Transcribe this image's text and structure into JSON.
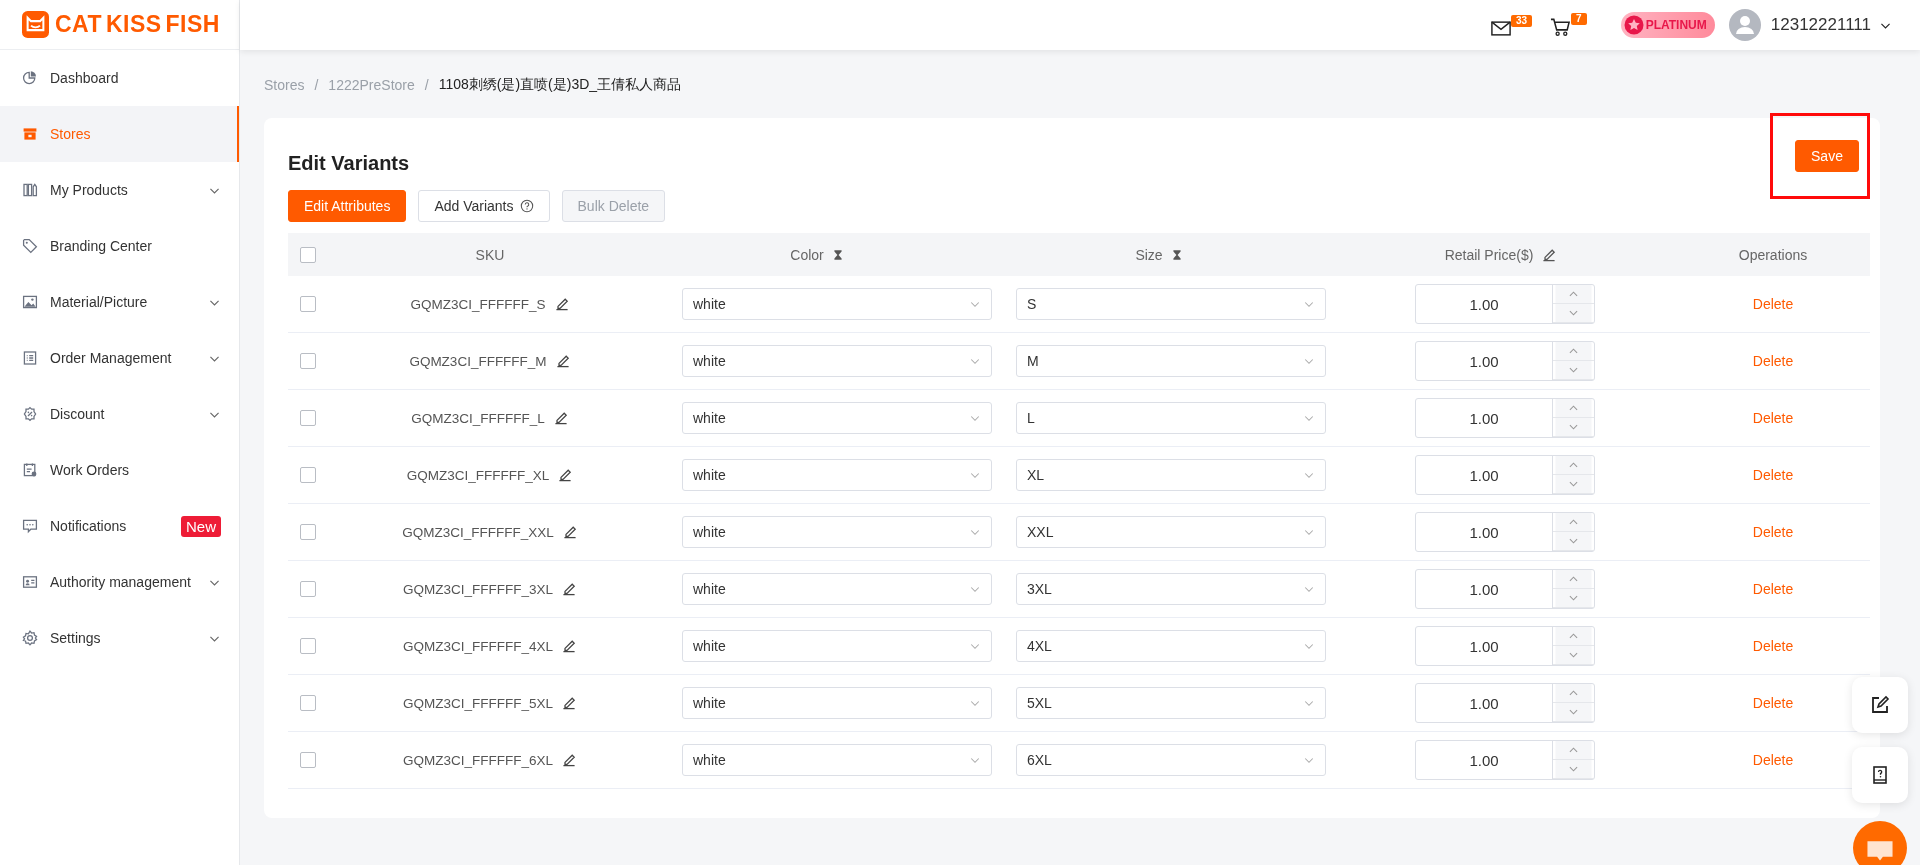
{
  "header": {
    "logo": "CAT KISS FISH",
    "mail_count": "33",
    "cart_count": "7",
    "level_badge": "PLATINUM",
    "username": "12312221111"
  },
  "sidebar": {
    "items": [
      {
        "label": "Dashboard",
        "selected": false,
        "expandable": false
      },
      {
        "label": "Stores",
        "selected": true,
        "expandable": false
      },
      {
        "label": "My Products",
        "selected": false,
        "expandable": true
      },
      {
        "label": "Branding Center",
        "selected": false,
        "expandable": false
      },
      {
        "label": "Material/Picture",
        "selected": false,
        "expandable": true
      },
      {
        "label": "Order Management",
        "selected": false,
        "expandable": true
      },
      {
        "label": "Discount",
        "selected": false,
        "expandable": true
      },
      {
        "label": "Work Orders",
        "selected": false,
        "expandable": false
      },
      {
        "label": "Notifications",
        "selected": false,
        "expandable": false,
        "badge": "New"
      },
      {
        "label": "Authority management",
        "selected": false,
        "expandable": true
      },
      {
        "label": "Settings",
        "selected": false,
        "expandable": true
      }
    ]
  },
  "breadcrumb": [
    {
      "label": "Stores"
    },
    {
      "separator": "/",
      "label": "1222PreStore"
    },
    {
      "separator": "/",
      "label": "1108刺绣(是)直喷(是)3D_王倩私人商品"
    }
  ],
  "card": {
    "title": "Edit Variants",
    "save_button": "Save",
    "save_highlighted": true,
    "buttons": [
      {
        "label": "Edit Attributes",
        "kind": "primary",
        "help": false,
        "disabled": false
      },
      {
        "label": "Add Variants",
        "kind": "default",
        "help": true,
        "disabled": false
      },
      {
        "label": "Bulk Delete",
        "kind": "default",
        "help": false,
        "disabled": true
      }
    ]
  },
  "table": {
    "all_checked": false,
    "columns": [
      {
        "label": "SKU",
        "kind": "plain"
      },
      {
        "label": "Color",
        "kind": "sortable"
      },
      {
        "label": "Size",
        "kind": "sortable"
      },
      {
        "label": "Retail Price($)",
        "kind": "editable"
      },
      {
        "label": "Operations",
        "kind": "plain"
      }
    ],
    "rows": [
      {
        "checked": false,
        "sku": "GQMZ3CI_FFFFFF_S",
        "color_name": "white",
        "size": "S",
        "price": "1.00",
        "operation": "Delete"
      },
      {
        "checked": false,
        "sku": "GQMZ3CI_FFFFFF_M",
        "color_name": "white",
        "size": "M",
        "price": "1.00",
        "operation": "Delete"
      },
      {
        "checked": false,
        "sku": "GQMZ3CI_FFFFFF_L",
        "color_name": "white",
        "size": "L",
        "price": "1.00",
        "operation": "Delete"
      },
      {
        "checked": false,
        "sku": "GQMZ3CI_FFFFFF_XL",
        "color_name": "white",
        "size": "XL",
        "price": "1.00",
        "operation": "Delete"
      },
      {
        "checked": false,
        "sku": "GQMZ3CI_FFFFFF_XXL",
        "color_name": "white",
        "size": "XXL",
        "price": "1.00",
        "operation": "Delete"
      },
      {
        "checked": false,
        "sku": "GQMZ3CI_FFFFFF_3XL",
        "color_name": "white",
        "size": "3XL",
        "price": "1.00",
        "operation": "Delete"
      },
      {
        "checked": false,
        "sku": "GQMZ3CI_FFFFFF_4XL",
        "color_name": "white",
        "size": "4XL",
        "price": "1.00",
        "operation": "Delete"
      },
      {
        "checked": false,
        "sku": "GQMZ3CI_FFFFFF_5XL",
        "color_name": "white",
        "size": "5XL",
        "price": "1.00",
        "operation": "Delete"
      },
      {
        "checked": false,
        "sku": "GQMZ3CI_FFFFFF_6XL",
        "color_name": "white",
        "size": "6XL",
        "price": "1.00",
        "operation": "Delete"
      }
    ]
  }
}
